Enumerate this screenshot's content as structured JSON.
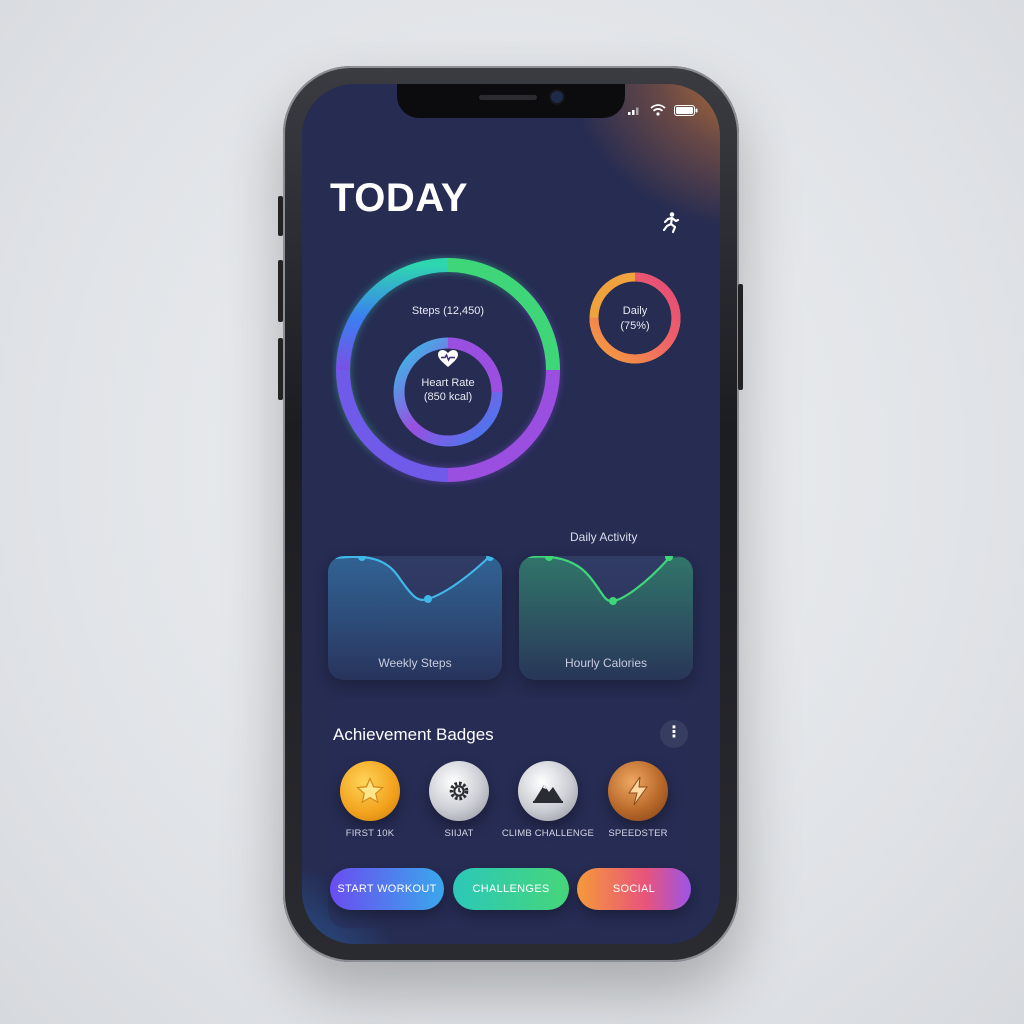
{
  "header": {
    "title": "TODAY",
    "activity_icon": "runner-icon"
  },
  "status_bar": {
    "icons": [
      "signal-icon",
      "wifi-icon",
      "battery-icon"
    ]
  },
  "rings": {
    "main": {
      "outer_label": "Steps (12,450)",
      "inner_label": "Heart Rate",
      "inner_sublabel": "(850 kcal)",
      "inner_icon": "heart-pulse-icon"
    },
    "daily": {
      "label": "Daily",
      "sublabel": "(75%)",
      "progress": 0.75
    }
  },
  "charts": {
    "section_title": "Daily Activity",
    "weekly_label": "Weekly Steps",
    "hourly_label": "Hourly Calories"
  },
  "badges": {
    "title": "Achievement Badges",
    "items": [
      {
        "label": "FIRST 10K",
        "icon": "star-icon"
      },
      {
        "label": "SIIJAT",
        "icon": "gear-icon"
      },
      {
        "label": "CLIMB CHALLENGE",
        "icon": "mountain-icon"
      },
      {
        "label": "SPEEDSTER",
        "icon": "lightning-icon"
      }
    ]
  },
  "actions": {
    "start_workout": "START WORKOUT",
    "challenges": "CHALLENGES",
    "social": "SOCIAL"
  },
  "colors": {
    "background": "#262c52",
    "accent_orange": "#d6802e",
    "ring_green": "#3fd67a",
    "ring_purple": "#9a4fe0",
    "ring_blue": "#3b7ff0"
  }
}
